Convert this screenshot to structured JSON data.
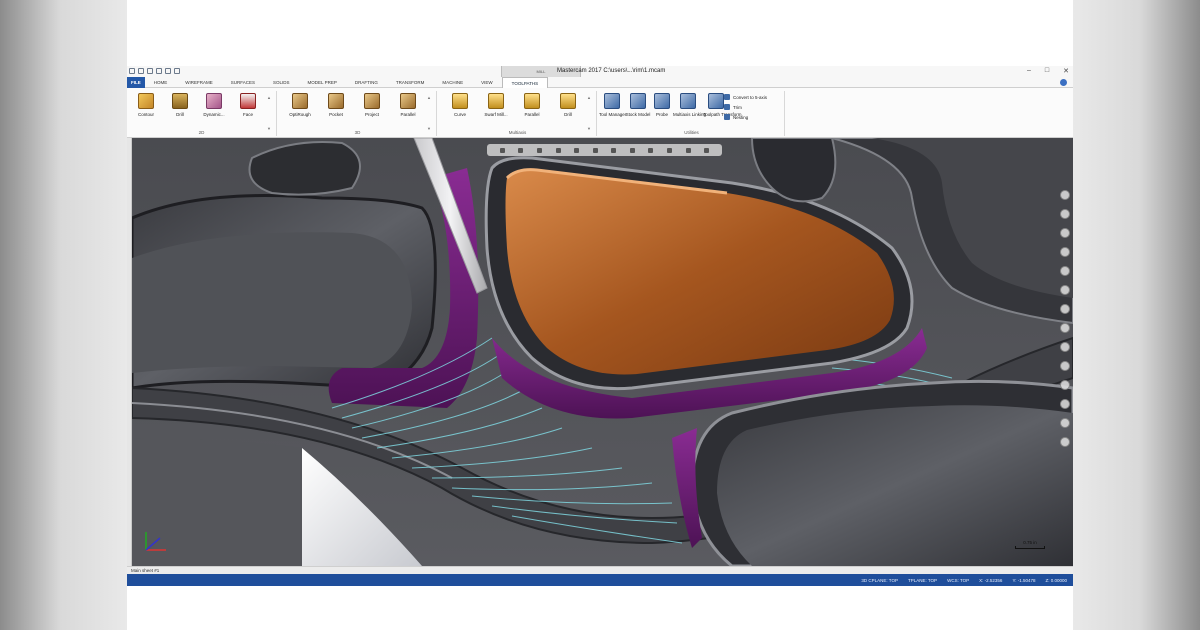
{
  "title_bar": {
    "title": "Mastercam 2017 C:\\users\\...\\rim\\1.mcam",
    "context_tab_group": "MILL",
    "window_controls": [
      "minimize-icon",
      "maximize-icon",
      "close-icon"
    ]
  },
  "tabs": [
    {
      "label": "FILE",
      "kind": "file"
    },
    {
      "label": "HOME"
    },
    {
      "label": "WIREFRAME"
    },
    {
      "label": "SURFACES"
    },
    {
      "label": "SOLIDS"
    },
    {
      "label": "MODEL PREP"
    },
    {
      "label": "DRAFTING"
    },
    {
      "label": "TRANSFORM"
    },
    {
      "label": "MACHINE"
    },
    {
      "label": "VIEW"
    },
    {
      "label": "TOOLPATHS",
      "active": true
    }
  ],
  "ribbon": {
    "group_2d": {
      "label": "2D",
      "buttons": [
        {
          "label": "Contour",
          "icon": "contour-icon"
        },
        {
          "label": "Drill",
          "icon": "drill-icon"
        },
        {
          "label": "Dynamic...",
          "icon": "dynamic-mill-icon"
        },
        {
          "label": "Face",
          "icon": "face-icon"
        }
      ]
    },
    "group_3d": {
      "label": "3D",
      "buttons": [
        {
          "label": "OptiRough",
          "icon": "optirough-icon"
        },
        {
          "label": "Pocket",
          "icon": "pocket-icon"
        },
        {
          "label": "Project",
          "icon": "project-icon"
        },
        {
          "label": "Parallel",
          "icon": "parallel-icon"
        }
      ]
    },
    "group_multiaxis": {
      "label": "Multiaxis",
      "buttons": [
        {
          "label": "Curve",
          "icon": "curve-icon"
        },
        {
          "label": "Swarf Mill...",
          "icon": "swarf-mill-icon"
        },
        {
          "label": "Parallel",
          "icon": "parallel-multiaxis-icon"
        },
        {
          "label": "Drill",
          "icon": "drill-multiaxis-icon"
        }
      ]
    },
    "group_utilities": {
      "label": "Utilities",
      "buttons": [
        {
          "label": "Tool Manager",
          "icon": "tool-manager-icon"
        },
        {
          "label": "Stock Model",
          "icon": "stock-model-icon"
        },
        {
          "label": "Probe",
          "icon": "probe-icon"
        },
        {
          "label": "Multiaxis Linking",
          "icon": "multiaxis-linking-icon"
        },
        {
          "label": "Toolpath Transform",
          "icon": "toolpath-transform-icon"
        }
      ],
      "side_buttons": [
        {
          "label": "Convert to 5-axis"
        },
        {
          "label": "Trim"
        },
        {
          "label": "Nesting"
        }
      ]
    }
  },
  "sheet_tab": "Main sheet #1",
  "status_bar": {
    "items": [
      "3D CPLANE: TOP",
      "TPLANE: TOP",
      "WCS: TOP",
      "X: -2.52356",
      "Y: -1.50478",
      "Z: 0.00000"
    ]
  },
  "scale_label": "0.75 in",
  "colors": {
    "status_bar": "#1f4e9b",
    "file_tab": "#2358a8",
    "pocket_copper": "#b8652a",
    "wall_purple": "#6b1f72",
    "toolpath_cyan": "#7fd6e0"
  }
}
